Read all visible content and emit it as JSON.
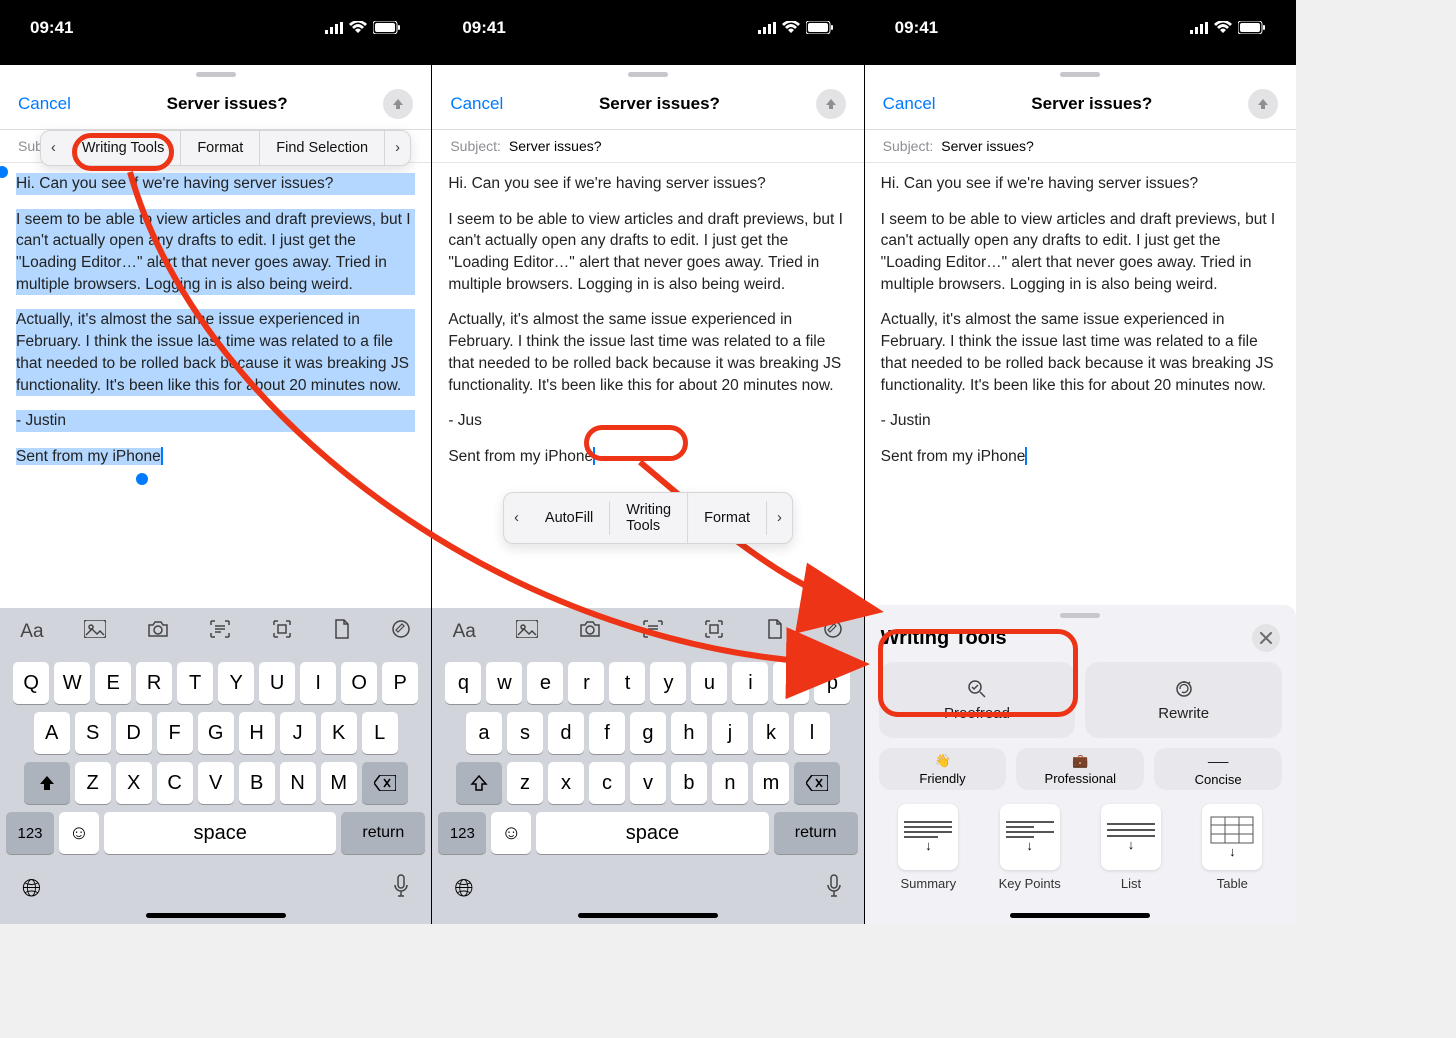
{
  "statusbar": {
    "time": "09:41"
  },
  "nav": {
    "cancel": "Cancel",
    "title": "Server issues?"
  },
  "subject": {
    "label": "Subject:",
    "value": "Server issues?"
  },
  "email": {
    "p1": "Hi. Can you see if we're having server issues?",
    "p2": "I seem to be able to view articles and draft previews, but I can't actually open any drafts to edit. I just get the \"Loading Editor…\" alert that never goes away. Tried in multiple browsers. Logging in is also being weird.",
    "p3": "Actually, it's almost the same issue experienced in February. I think the issue last time was related to a file that needed to be rolled back because it was breaking JS functionality. It's been like this for about 20 minutes now.",
    "p4": "- Justin",
    "p4_partial": "- Jus",
    "sig": "Sent from my iPhone"
  },
  "context_menu1": {
    "writing_tools": "Writing Tools",
    "format": "Format",
    "find_selection": "Find Selection"
  },
  "context_menu2": {
    "autofill": "AutoFill",
    "writing_tools": "Writing Tools",
    "format": "Format"
  },
  "keyboard": {
    "top_label_aa": "Aa",
    "rows_upper": [
      [
        "Q",
        "W",
        "E",
        "R",
        "T",
        "Y",
        "U",
        "I",
        "O",
        "P"
      ],
      [
        "A",
        "S",
        "D",
        "F",
        "G",
        "H",
        "J",
        "K",
        "L"
      ],
      [
        "Z",
        "X",
        "C",
        "V",
        "B",
        "N",
        "M"
      ]
    ],
    "rows_lower": [
      [
        "q",
        "w",
        "e",
        "r",
        "t",
        "y",
        "u",
        "i",
        "o",
        "p"
      ],
      [
        "a",
        "s",
        "d",
        "f",
        "g",
        "h",
        "j",
        "k",
        "l"
      ],
      [
        "z",
        "x",
        "c",
        "v",
        "b",
        "n",
        "m"
      ]
    ],
    "num": "123",
    "space": "space",
    "return": "return"
  },
  "writing_tools": {
    "title": "Writing Tools",
    "proofread": "Proofread",
    "rewrite": "Rewrite",
    "friendly": "Friendly",
    "professional": "Professional",
    "concise": "Concise",
    "summary": "Summary",
    "key_points": "Key Points",
    "list": "List",
    "table": "Table"
  }
}
